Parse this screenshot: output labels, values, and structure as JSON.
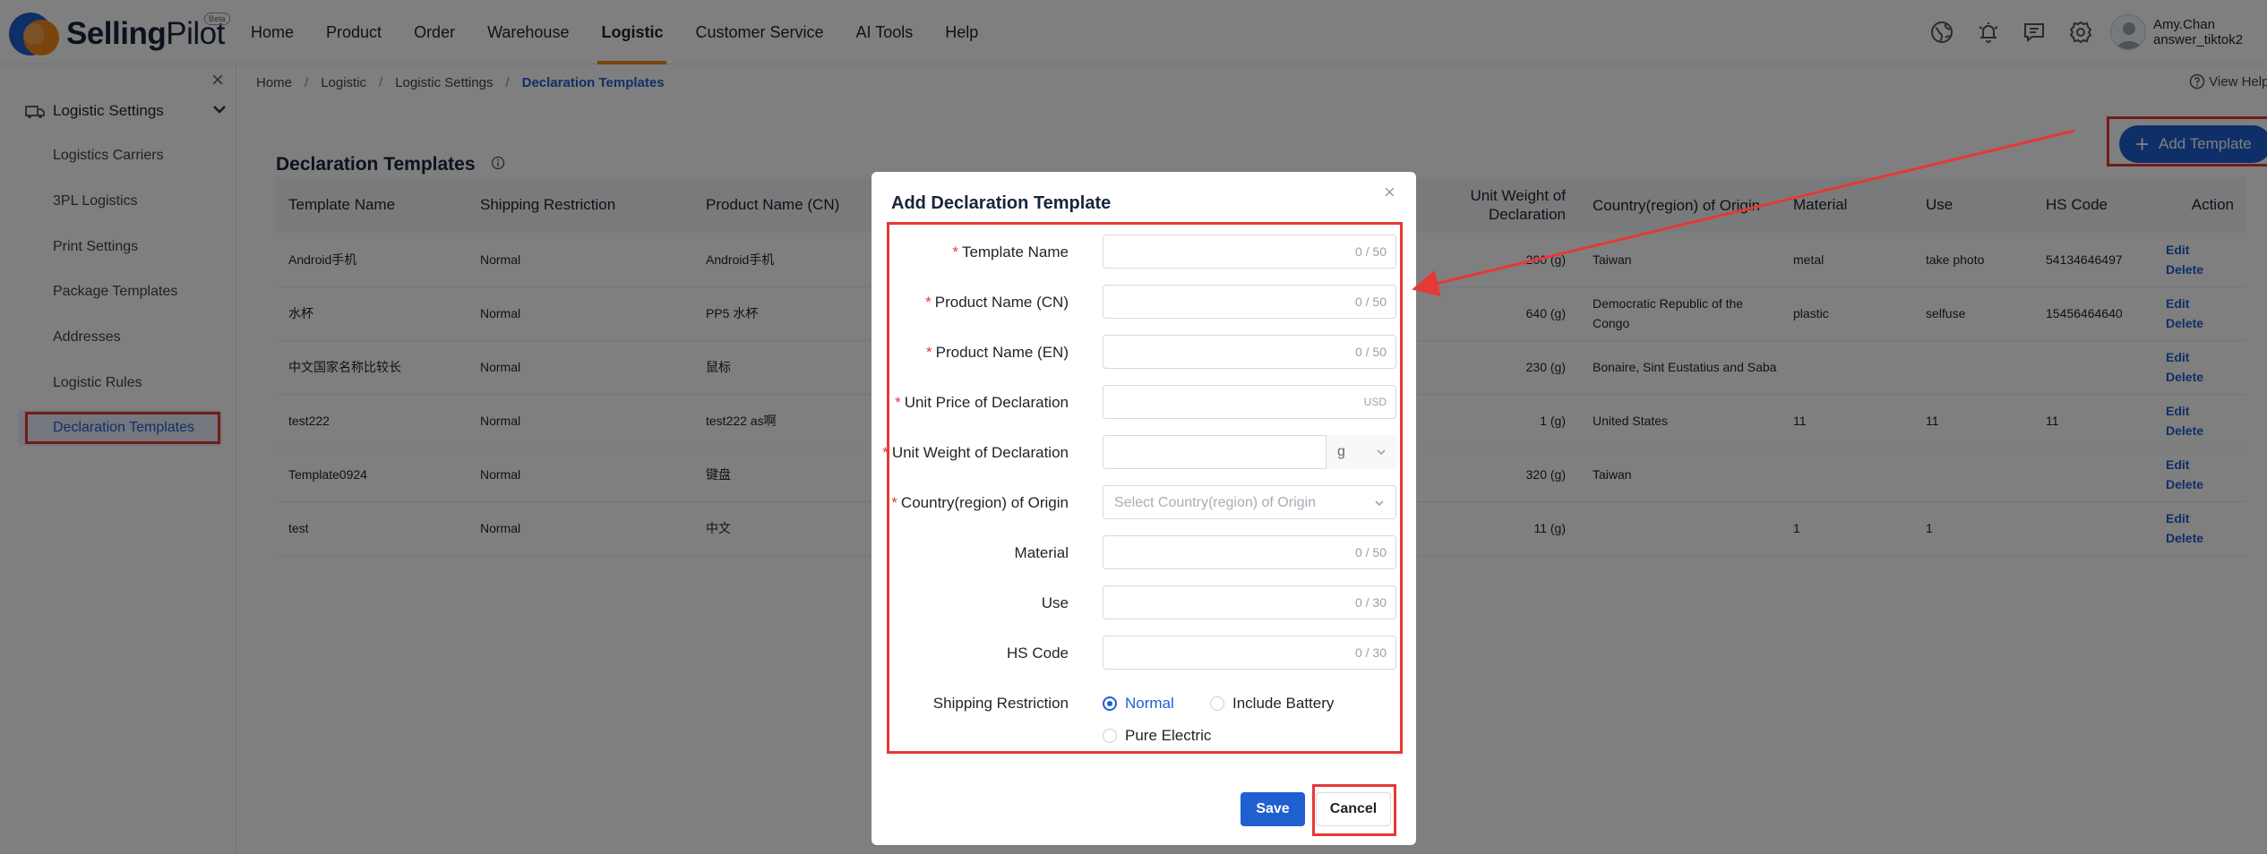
{
  "brand": {
    "name_bold": "Selling",
    "name_light": "Pilot",
    "badge": "Beta"
  },
  "nav": [
    "Home",
    "Product",
    "Order",
    "Warehouse",
    "Logistic",
    "Customer Service",
    "AI Tools",
    "Help"
  ],
  "user": {
    "name": "Amy.Chan",
    "account": "answer_tiktok2"
  },
  "sidebar": {
    "group": "Logistic Settings",
    "items": [
      "Logistics Carriers",
      "3PL Logistics",
      "Print Settings",
      "Package Templates",
      "Addresses",
      "Logistic Rules",
      "Declaration Templates"
    ]
  },
  "breadcrumb": [
    "Home",
    "Logistic",
    "Logistic Settings",
    "Declaration Templates"
  ],
  "view_help": "View Help",
  "page": {
    "title": "Declaration Templates",
    "add_label": "Add Template"
  },
  "table": {
    "headers": [
      "Template Name",
      "Shipping Restriction",
      "Product Name (CN)",
      "Unit Weight of Declaration",
      "Country(region) of Origin",
      "Material",
      "Use",
      "HS Code",
      "Action"
    ],
    "rows": [
      {
        "name": "Android手机",
        "restriction": "Normal",
        "cn": "Android手机",
        "weight": "200 (g)",
        "origin": "Taiwan",
        "material": "metal",
        "use": "take photo",
        "hs": "54134646497"
      },
      {
        "name": "水杯",
        "restriction": "Normal",
        "cn": "PP5 水杯",
        "weight": "640 (g)",
        "origin": "Democratic Republic of the Congo",
        "material": "plastic",
        "use": "selfuse",
        "hs": "15456464640"
      },
      {
        "name": "中文国家名称比较长",
        "restriction": "Normal",
        "cn": "鼠标",
        "weight": "230 (g)",
        "origin": "Bonaire, Sint Eustatius and Saba",
        "material": "",
        "use": "",
        "hs": ""
      },
      {
        "name": "test222",
        "restriction": "Normal",
        "cn": "test222 as啊",
        "weight": "1 (g)",
        "origin": "United States",
        "material": "11",
        "use": "11",
        "hs": "11"
      },
      {
        "name": "Template0924",
        "restriction": "Normal",
        "cn": "键盘",
        "weight": "320 (g)",
        "origin": "Taiwan",
        "material": "",
        "use": "",
        "hs": ""
      },
      {
        "name": "test",
        "restriction": "Normal",
        "cn": "中文",
        "weight": "11 (g)",
        "origin": "",
        "material": "1",
        "use": "1",
        "hs": ""
      }
    ],
    "actions": {
      "edit": "Edit",
      "delete": "Delete"
    }
  },
  "modal": {
    "title": "Add Declaration Template",
    "fields": {
      "template_name": {
        "label": "Template Name",
        "counter": "0 / 50"
      },
      "product_cn": {
        "label": "Product Name (CN)",
        "counter": "0 / 50"
      },
      "product_en": {
        "label": "Product Name (EN)",
        "counter": "0 / 50"
      },
      "unit_price": {
        "label": "Unit Price of Declaration",
        "suffix": "USD"
      },
      "unit_weight": {
        "label": "Unit Weight of Declaration",
        "unit": "g"
      },
      "origin": {
        "label": "Country(region) of Origin",
        "placeholder": "Select Country(region) of Origin"
      },
      "material": {
        "label": "Material",
        "counter": "0 / 50"
      },
      "use": {
        "label": "Use",
        "counter": "0 / 30"
      },
      "hs_code": {
        "label": "HS Code",
        "counter": "0 / 30"
      }
    },
    "shipping": {
      "label": "Shipping Restriction",
      "options": [
        "Normal",
        "Include Battery",
        "Pure Electric"
      ],
      "selected": "Normal"
    },
    "save": "Save",
    "cancel": "Cancel"
  },
  "colors": {
    "primary": "#1f5fd0",
    "annotation": "#e53935",
    "accent": "#f28a1a"
  }
}
